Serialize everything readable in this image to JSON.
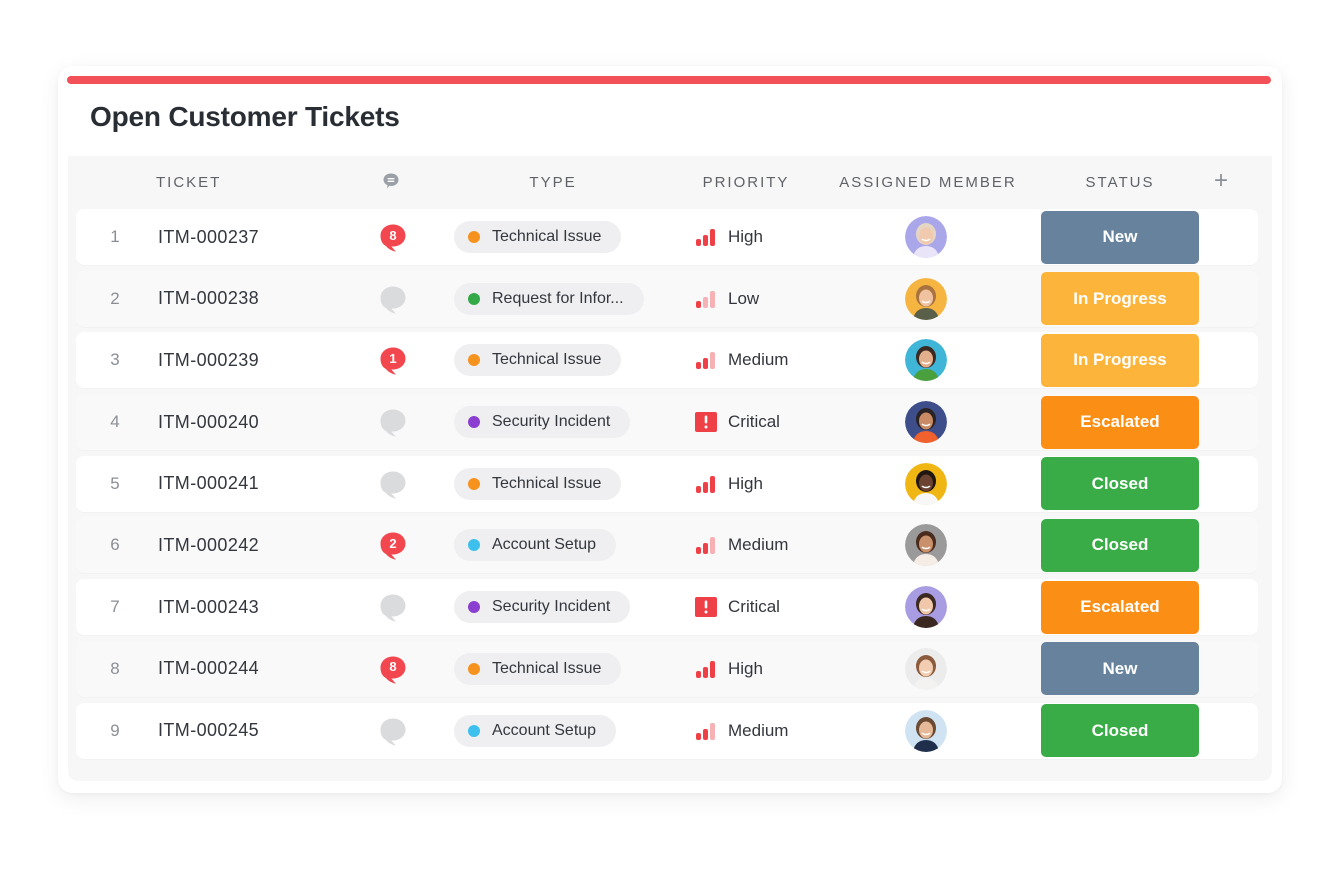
{
  "header": {
    "title": "Open Customer Tickets",
    "accent_color": "#f25157"
  },
  "columns": {
    "ticket": "TICKET",
    "comments_icon": "comment-icon",
    "type": "TYPE",
    "priority": "PRIORITY",
    "assigned_member": "ASSIGNED MEMBER",
    "status": "STATUS",
    "add_column_icon": "plus-icon"
  },
  "types": {
    "Technical Issue": "#f6921e",
    "Request for Information": "#35a948",
    "Security Incident": "#8b3fd0",
    "Account Setup": "#3ec0ee"
  },
  "statuses": {
    "New": "#66829d",
    "In Progress": "#fcb53a",
    "Escalated": "#fb8f16",
    "Closed": "#3aac47"
  },
  "rows": [
    {
      "num": "1",
      "ticket": "ITM-000237",
      "comments": "8",
      "type": "Technical Issue",
      "type_color": "#f6921e",
      "priority": "High",
      "member_avatar": "avatar-woman-gray-hair",
      "avatar_bg": "#a9a6ea",
      "status": "New",
      "status_color": "#66829d"
    },
    {
      "num": "2",
      "ticket": "ITM-000238",
      "comments": "",
      "type": "Request for Infor...",
      "type_color": "#35a948",
      "priority": "Low",
      "member_avatar": "avatar-young-man-laughing",
      "avatar_bg": "#f6b540",
      "status": "In Progress",
      "status_color": "#fcb53a"
    },
    {
      "num": "3",
      "ticket": "ITM-000239",
      "comments": "1",
      "type": "Technical Issue",
      "type_color": "#f6921e",
      "priority": "Medium",
      "member_avatar": "avatar-woman-green-top",
      "avatar_bg": "#3fb6d8",
      "status": "In Progress",
      "status_color": "#fcb53a"
    },
    {
      "num": "4",
      "ticket": "ITM-000240",
      "comments": "",
      "type": "Security Incident",
      "type_color": "#8b3fd0",
      "priority": "Critical",
      "member_avatar": "avatar-man-orange-shirt",
      "avatar_bg": "#3e4e8a",
      "status": "Escalated",
      "status_color": "#fb8f16"
    },
    {
      "num": "5",
      "ticket": "ITM-000241",
      "comments": "",
      "type": "Technical Issue",
      "type_color": "#f6921e",
      "priority": "High",
      "member_avatar": "avatar-man-smiling",
      "avatar_bg": "#f0b613",
      "status": "Closed",
      "status_color": "#3aac47"
    },
    {
      "num": "6",
      "ticket": "ITM-000242",
      "comments": "2",
      "type": "Account Setup",
      "type_color": "#3ec0ee",
      "priority": "Medium",
      "member_avatar": "avatar-woman-curly-hair",
      "avatar_bg": "#9a9a9a",
      "status": "Closed",
      "status_color": "#3aac47"
    },
    {
      "num": "7",
      "ticket": "ITM-000243",
      "comments": "",
      "type": "Security Incident",
      "type_color": "#8b3fd0",
      "priority": "Critical",
      "member_avatar": "avatar-woman-dark-hair",
      "avatar_bg": "#a89de3",
      "status": "Escalated",
      "status_color": "#fb8f16"
    },
    {
      "num": "8",
      "ticket": "ITM-000244",
      "comments": "8",
      "type": "Technical Issue",
      "type_color": "#f6921e",
      "priority": "High",
      "member_avatar": "avatar-woman-short-hair",
      "avatar_bg": "#ececec",
      "status": "New",
      "status_color": "#66829d"
    },
    {
      "num": "9",
      "ticket": "ITM-000245",
      "comments": "",
      "type": "Account Setup",
      "type_color": "#3ec0ee",
      "priority": "Medium",
      "member_avatar": "avatar-older-man",
      "avatar_bg": "#cfe3f3",
      "status": "Closed",
      "status_color": "#3aac47"
    }
  ]
}
